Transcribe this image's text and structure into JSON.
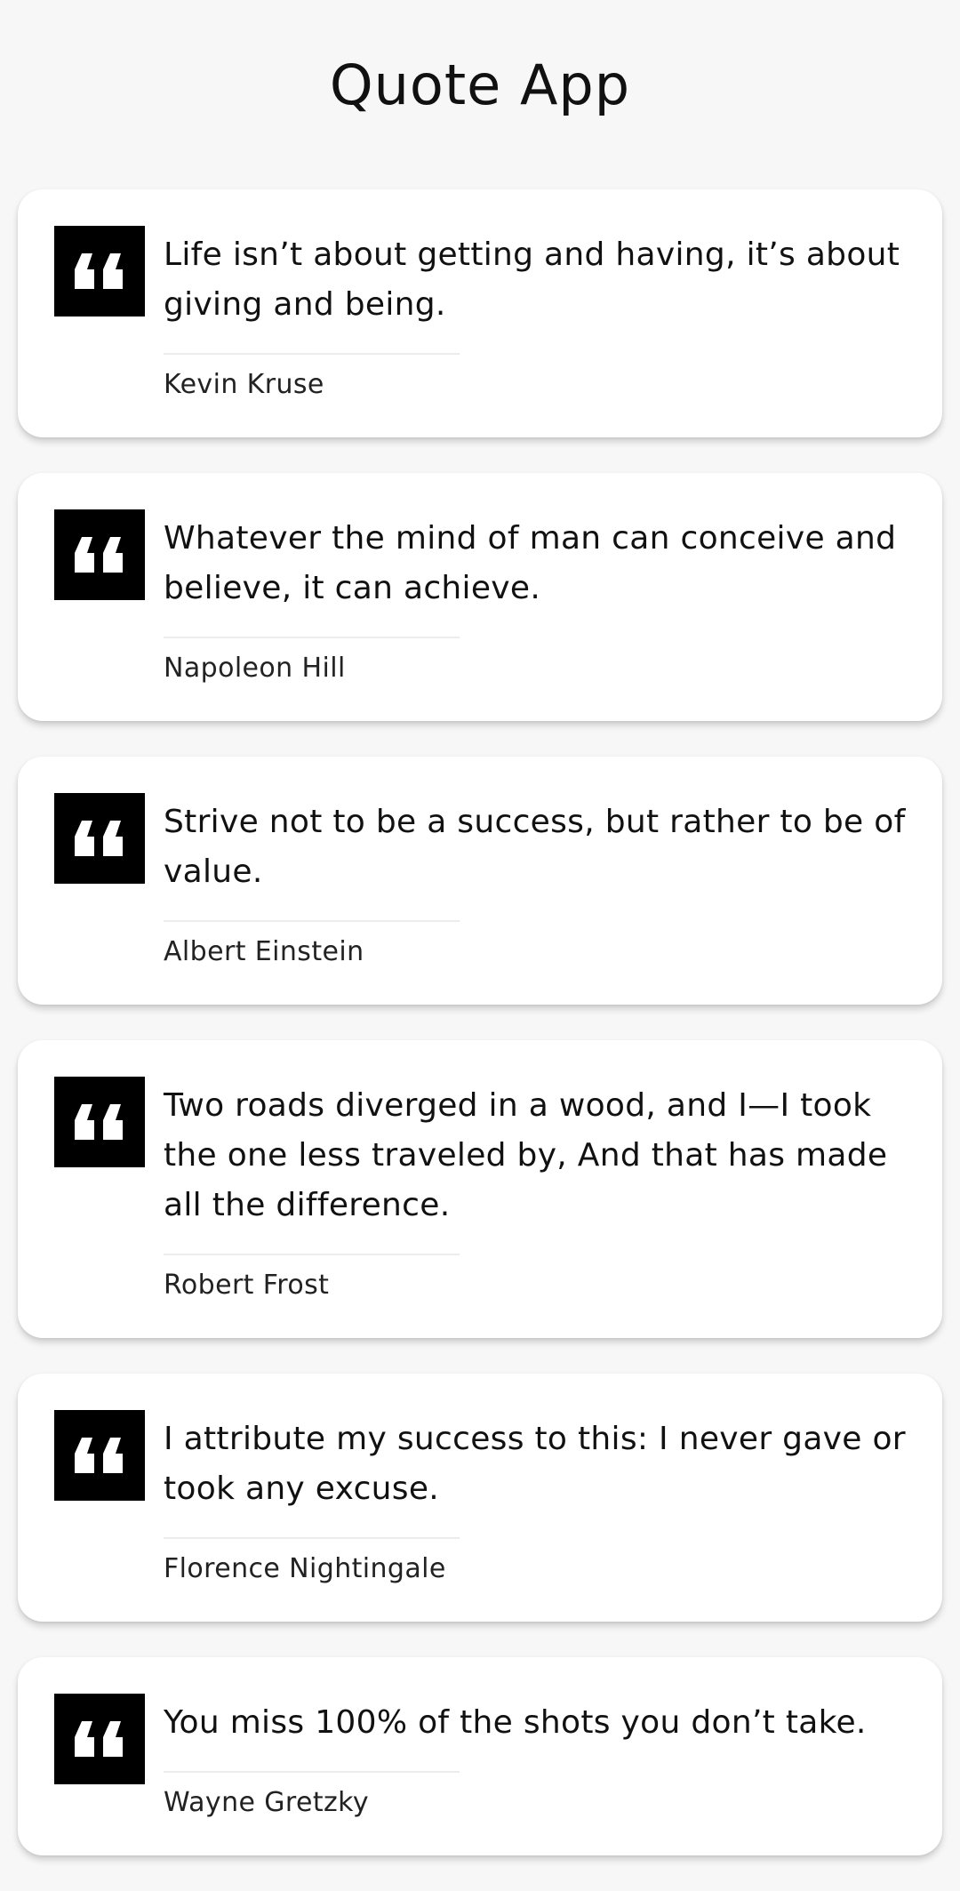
{
  "app": {
    "title": "Quote App"
  },
  "quotes": [
    {
      "text": "Life isn’t about getting and having, it’s about giving and being.",
      "author": "Kevin Kruse",
      "icon": "quote-icon"
    },
    {
      "text": "Whatever the mind of man can conceive and believe, it can achieve.",
      "author": "Napoleon Hill",
      "icon": "quote-icon"
    },
    {
      "text": "Strive not to be a success, but rather to be of value.",
      "author": "Albert Einstein",
      "icon": "quote-icon"
    },
    {
      "text": "Two roads diverged in a wood, and I—I took the one less traveled by, And that has made all the difference.",
      "author": "Robert Frost",
      "icon": "quote-icon"
    },
    {
      "text": "I attribute my success to this: I never gave or took any excuse.",
      "author": "Florence Nightingale",
      "icon": "quote-icon"
    },
    {
      "text": "You miss 100% of the shots you don’t take.",
      "author": "Wayne Gretzky",
      "icon": "quote-icon"
    }
  ],
  "colors": {
    "background": "#f7f7f7",
    "card": "#ffffff",
    "icon_bg": "#000000",
    "icon_fg": "#ffffff",
    "divider": "#ececec"
  }
}
